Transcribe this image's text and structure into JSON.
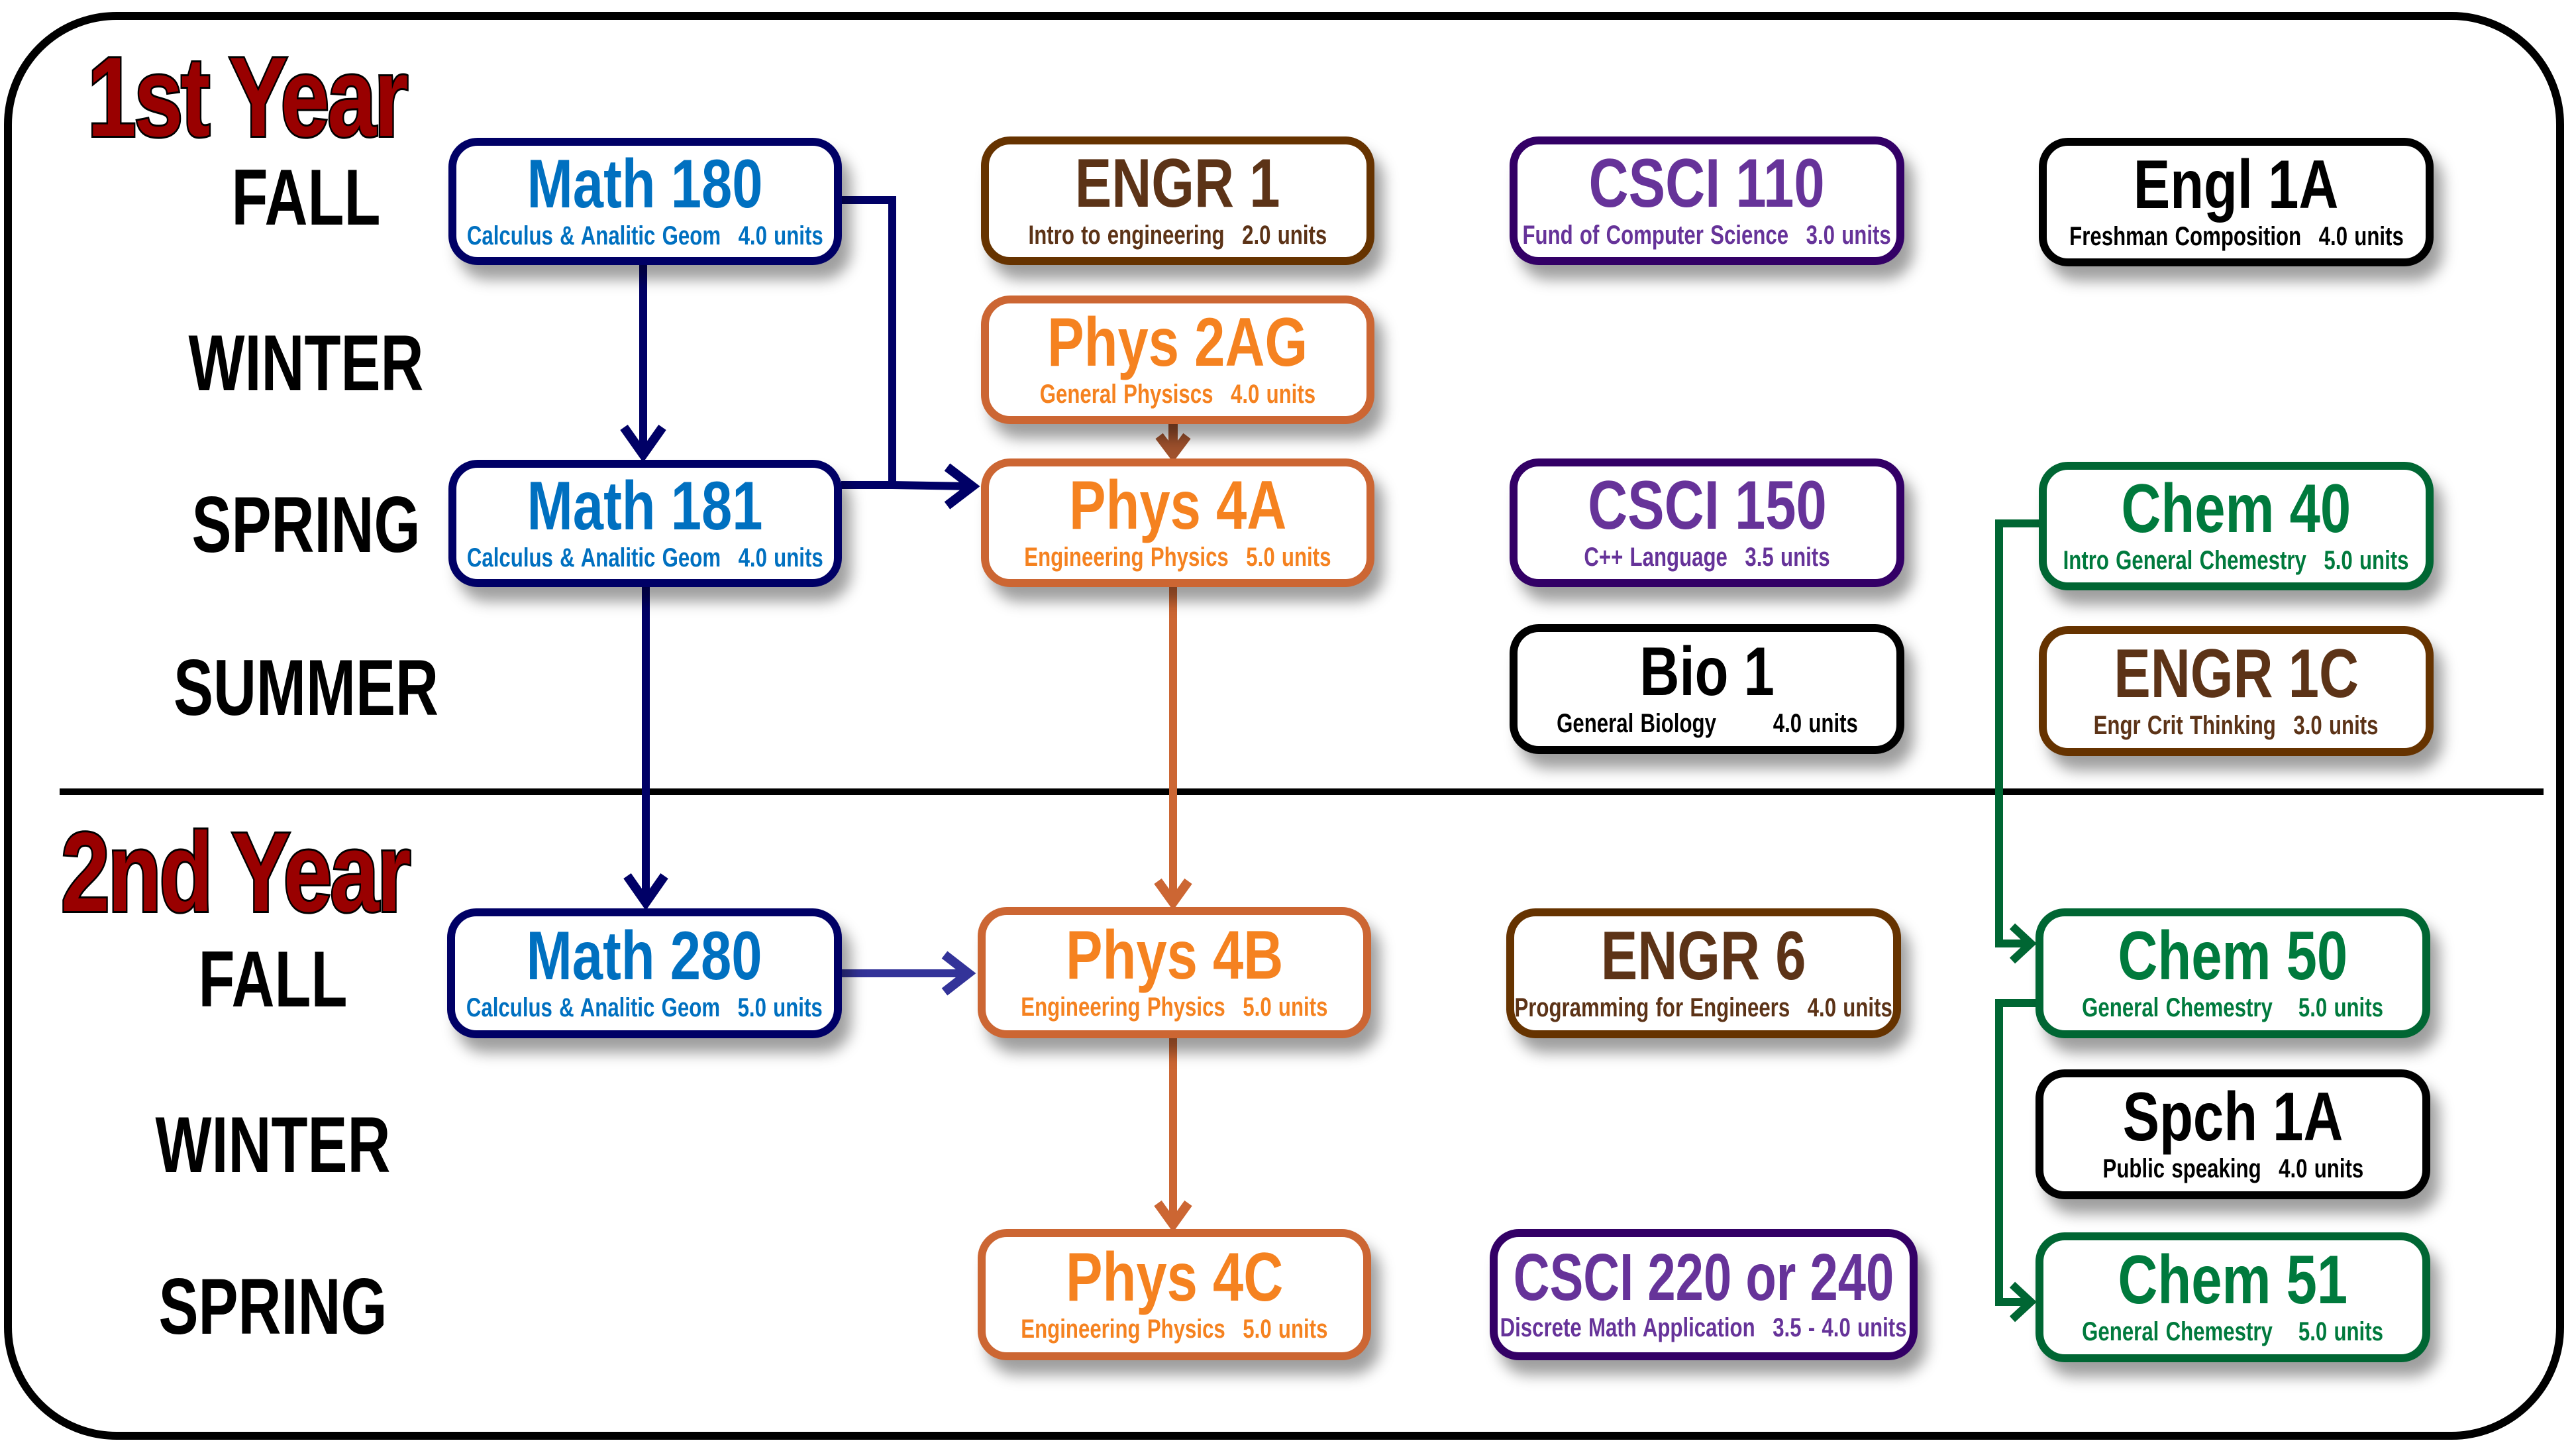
{
  "years": [
    {
      "title": "1st Year",
      "terms": [
        "FALL",
        "WINTER",
        "SPRING",
        "SUMMER"
      ]
    },
    {
      "title": "2nd Year",
      "terms": [
        "FALL",
        "WINTER",
        "SPRING"
      ]
    }
  ],
  "colors": {
    "year_title": "#990000",
    "math_border": "#000066",
    "math_text": "#0070c0",
    "phys_border": "#cc6633",
    "phys_text": "#f58220",
    "engr_border": "#663300",
    "engr_text": "#5c3317",
    "csci_border": "#330066",
    "csci_text": "#663399",
    "chem_border": "#006633",
    "chem_text": "#007a3d",
    "general_border": "#000000"
  },
  "courses": {
    "math180": {
      "code": "Math 180",
      "title": "Calculus & Analitic Geom",
      "units": "4.0 units"
    },
    "math181": {
      "code": "Math 181",
      "title": "Calculus & Analitic Geom",
      "units": "4.0 units"
    },
    "math280": {
      "code": "Math 280",
      "title": "Calculus & Analitic Geom",
      "units": "5.0 units"
    },
    "engr1": {
      "code": "ENGR 1",
      "title": "Intro to engineering",
      "units": "2.0 units"
    },
    "phys2ag": {
      "code": "Phys 2AG",
      "title": "General Physiscs",
      "units": "4.0 units"
    },
    "phys4a": {
      "code": "Phys 4A",
      "title": "Engineering Physics",
      "units": "5.0 units"
    },
    "phys4b": {
      "code": "Phys 4B",
      "title": "Engineering Physics",
      "units": "5.0 units"
    },
    "phys4c": {
      "code": "Phys 4C",
      "title": "Engineering Physics",
      "units": "5.0 units"
    },
    "csci110": {
      "code": "CSCI 110",
      "title": "Fund of Computer Science",
      "units": "3.0 units"
    },
    "csci150": {
      "code": "CSCI 150",
      "title": "C++ Language",
      "units": "3.5 units"
    },
    "bio1": {
      "code": "Bio 1",
      "title": "General Biology",
      "units": "4.0 units"
    },
    "engr6": {
      "code": "ENGR 6",
      "title": "Programming for Engineers",
      "units": "4.0 units"
    },
    "csci220": {
      "code": "CSCI 220 or 240",
      "title": "Discrete Math Application",
      "units": "3.5 - 4.0 units"
    },
    "engl1a": {
      "code": "Engl 1A",
      "title": "Freshman Composition",
      "units": "4.0 units"
    },
    "chem40": {
      "code": "Chem 40",
      "title": "Intro General Chemestry",
      "units": "5.0 units"
    },
    "engr1c": {
      "code": "ENGR 1C",
      "title": "Engr Crit Thinking",
      "units": "3.0 units"
    },
    "chem50": {
      "code": "Chem 50",
      "title": "General Chemestry",
      "units": "5.0 units"
    },
    "spch1a": {
      "code": "Spch 1A",
      "title": "Public speaking",
      "units": "4.0 units"
    },
    "chem51": {
      "code": "Chem 51",
      "title": "General Chemestry",
      "units": "5.0 units"
    }
  },
  "prerequisites": [
    {
      "from": "Math 180",
      "to": "Math 181"
    },
    {
      "from": "Math 180",
      "to": "Phys 4A"
    },
    {
      "from": "Math 181",
      "to": "Math 280"
    },
    {
      "from": "Phys 2AG",
      "to": "Phys 4A"
    },
    {
      "from": "Phys 4A",
      "to": "Phys 4B"
    },
    {
      "from": "Math 280",
      "to": "Phys 4B"
    },
    {
      "from": "Phys 4B",
      "to": "Phys 4C"
    },
    {
      "from": "Chem 40",
      "to": "Chem 50"
    },
    {
      "from": "Chem 50",
      "to": "Chem 51"
    }
  ]
}
